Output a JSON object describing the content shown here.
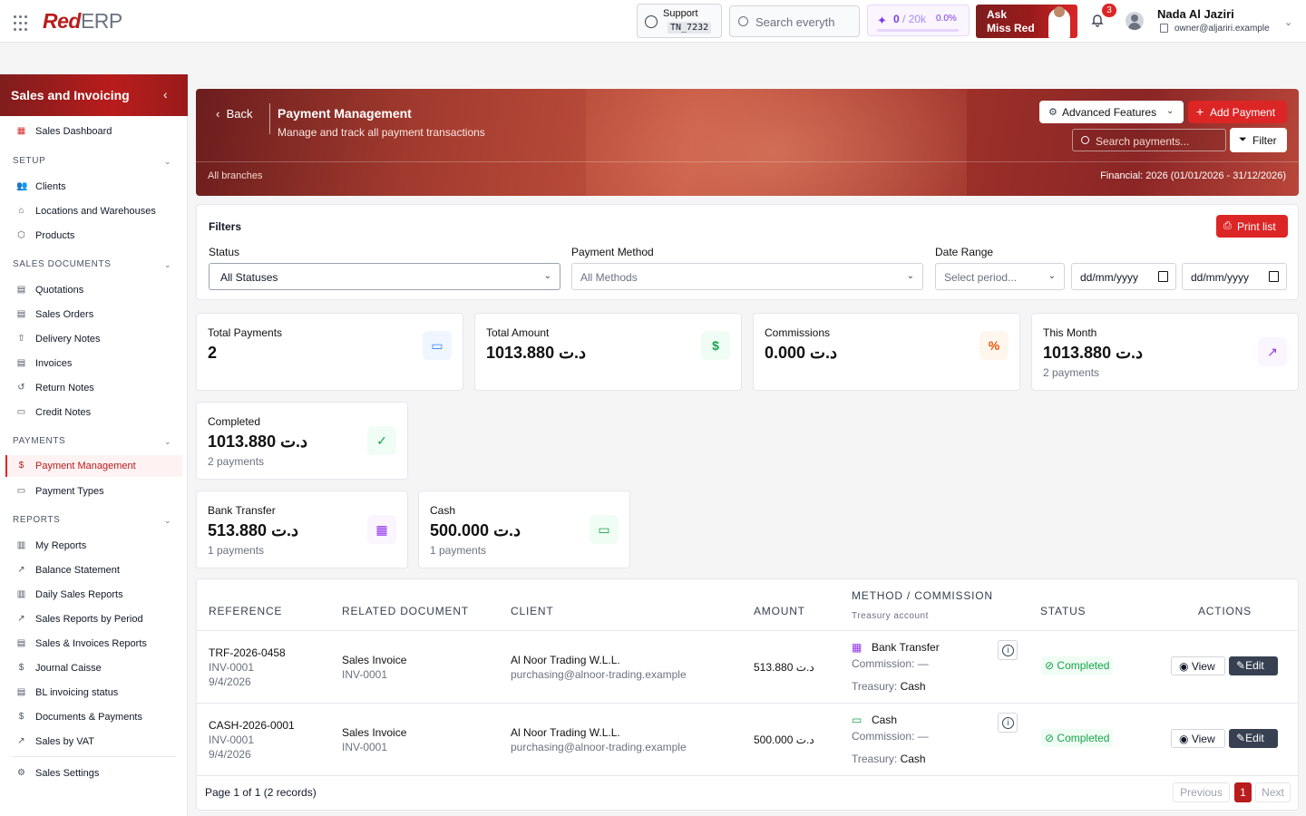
{
  "topbar": {
    "logo_red": "Red",
    "logo_erp": "ERP",
    "support_label": "Support",
    "support_code": "TN_7232",
    "search_placeholder": "Search everyth",
    "credits_used": "0",
    "credits_total": "/ 20k",
    "credits_percent": "0.0%",
    "credits_fraction": 0.0,
    "ask_line1": "Ask",
    "ask_line2": "Miss Red",
    "notification_count": "3",
    "user_name": "Nada Al Jaziri",
    "user_email": "owner@aljariri.example"
  },
  "sidebar": {
    "title": "Sales and Invoicing",
    "dashboard": "Sales Dashboard",
    "sections": {
      "setup": "SETUP",
      "sales_documents": "SALES DOCUMENTS",
      "payments": "PAYMENTS",
      "reports": "REPORTS"
    },
    "setup_items": [
      "Clients",
      "Locations and Warehouses",
      "Products"
    ],
    "sales_doc_items": [
      "Quotations",
      "Sales Orders",
      "Delivery Notes",
      "Invoices",
      "Return Notes",
      "Credit Notes"
    ],
    "payment_items": [
      "Payment Management",
      "Payment Types"
    ],
    "report_items": [
      "My Reports",
      "Balance Statement",
      "Daily Sales Reports",
      "Sales Reports by Period",
      "Sales & Invoices Reports",
      "Journal Caisse",
      "BL invoicing status",
      "Documents & Payments",
      "Sales by VAT"
    ],
    "settings": "Sales Settings"
  },
  "hero": {
    "back": "Back",
    "title": "Payment Management",
    "subtitle": "Manage and track all payment transactions",
    "branches": "All branches",
    "financial": "Financial: 2026 (01/01/2026 - 31/12/2026)",
    "advanced": "Advanced Features",
    "add_payment": "Add Payment",
    "search_placeholder": "Search payments...",
    "filter": "Filter"
  },
  "filters": {
    "heading": "Filters",
    "print": "Print list",
    "status_label": "Status",
    "status_value": "All Statuses",
    "method_label": "Payment Method",
    "method_value": "All Methods",
    "date_label": "Date Range",
    "period_placeholder": "Select period...",
    "date_from": "dd/mm/yyyy",
    "date_to": "dd/mm/yyyy"
  },
  "stats": {
    "total_payments": {
      "label": "Total Payments",
      "value": "2"
    },
    "total_amount": {
      "label": "Total Amount",
      "value": "1013.880 د.ت"
    },
    "commissions": {
      "label": "Commissions",
      "value": "0.000 د.ت"
    },
    "this_month": {
      "label": "This Month",
      "value": "1013.880 د.ت",
      "sub": "2 payments"
    },
    "completed": {
      "label": "Completed",
      "value": "1013.880 د.ت",
      "sub": "2 payments"
    },
    "bank_transfer": {
      "label": "Bank Transfer",
      "value": "513.880 د.ت",
      "sub": "1 payments"
    },
    "cash": {
      "label": "Cash",
      "value": "500.000 د.ت",
      "sub": "1 payments"
    }
  },
  "table": {
    "headers": {
      "reference": "REFERENCE",
      "related": "RELATED DOCUMENT",
      "client": "CLIENT",
      "amount": "AMOUNT",
      "method": "METHOD / COMMISSION",
      "method_sub": "Treasury account",
      "status": "STATUS",
      "actions": "ACTIONS"
    },
    "rows": [
      {
        "ref": "TRF-2026-0458",
        "invoice": "INV-0001",
        "date": "9/4/2026",
        "doc_type": "Sales Invoice",
        "doc_ref": "INV-0001",
        "client": "Al Noor Trading W.L.L.",
        "client_email": "purchasing@alnoor-trading.example",
        "amount": "513.880 د.ت",
        "method": "Bank Transfer",
        "commission_label": "Commission:",
        "commission": "—",
        "treasury_label": "Treasury:",
        "treasury": "Cash",
        "status": "Completed",
        "view": "View",
        "edit": "Edit"
      },
      {
        "ref": "CASH-2026-0001",
        "invoice": "INV-0001",
        "date": "9/4/2026",
        "doc_type": "Sales Invoice",
        "doc_ref": "INV-0001",
        "client": "Al Noor Trading W.L.L.",
        "client_email": "purchasing@alnoor-trading.example",
        "amount": "500.000 د.ت",
        "method": "Cash",
        "commission_label": "Commission:",
        "commission": "—",
        "treasury_label": "Treasury:",
        "treasury": "Cash",
        "status": "Completed",
        "view": "View",
        "edit": "Edit"
      }
    ],
    "pager": {
      "summary": "Page 1 of 1 (2 records)",
      "previous": "Previous",
      "current": "1",
      "next": "Next"
    }
  },
  "colors": {
    "brand_red": "#dc2626",
    "success_green": "#16a34a"
  }
}
